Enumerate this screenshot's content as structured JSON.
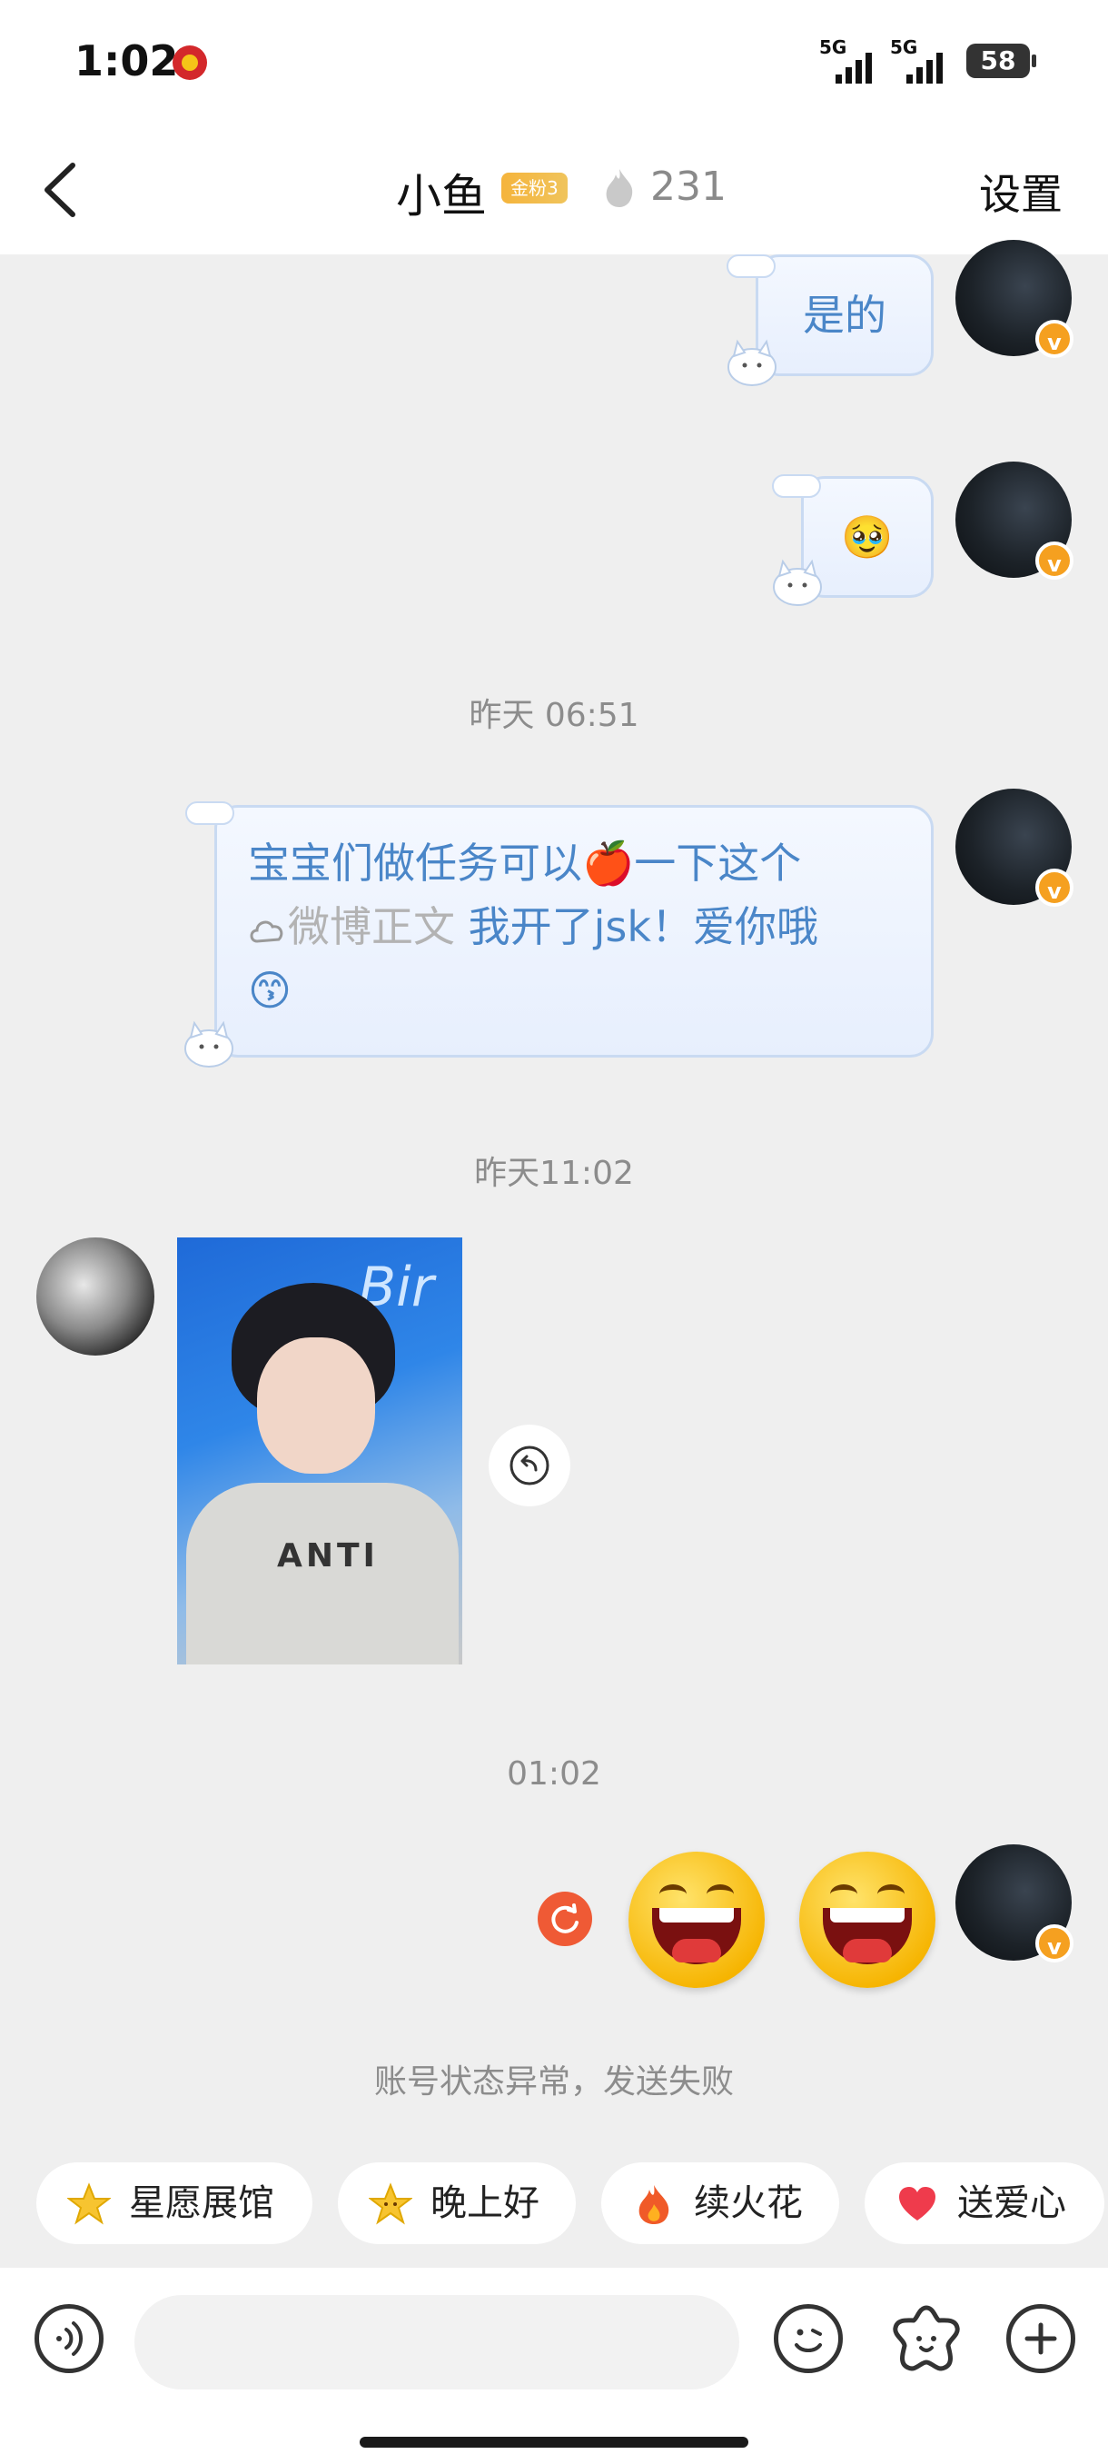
{
  "status_bar": {
    "time": "1:02",
    "signal_1": "5G",
    "signal_2": "5G",
    "battery": "58"
  },
  "header": {
    "title": "小鱼",
    "fan_badge": "金粉3",
    "fire_count": "231",
    "settings_label": "设置"
  },
  "messages": {
    "msg1_text": "是的",
    "msg2_emoji": "🥹",
    "time_1": "昨天 06:51",
    "msg3_part1": "宝宝们做任务可以",
    "msg3_apple": "🍎",
    "msg3_part2": "一下这个",
    "msg3_link": "微博正文",
    "msg3_part3": " 我开了jsk！爱你哦",
    "msg3_emoji": "😙",
    "time_2": "昨天11:02",
    "photo_bg_text": "Bir",
    "photo_shirt_text": "ANTI",
    "time_3": "01:02",
    "failed_note": "账号状态异常，发送失败"
  },
  "quick_replies": [
    {
      "label": "星愿展馆",
      "icon": "star-icon"
    },
    {
      "label": "晚上好",
      "icon": "star-face-icon"
    },
    {
      "label": "续火花",
      "icon": "fire-icon"
    },
    {
      "label": "送爱心",
      "icon": "heart-icon"
    }
  ],
  "composer": {
    "placeholder": ""
  },
  "colors": {
    "bubble_text": "#4a86c8",
    "badge": "#f5a020",
    "retry": "#ef5a35",
    "background": "#efefef"
  }
}
